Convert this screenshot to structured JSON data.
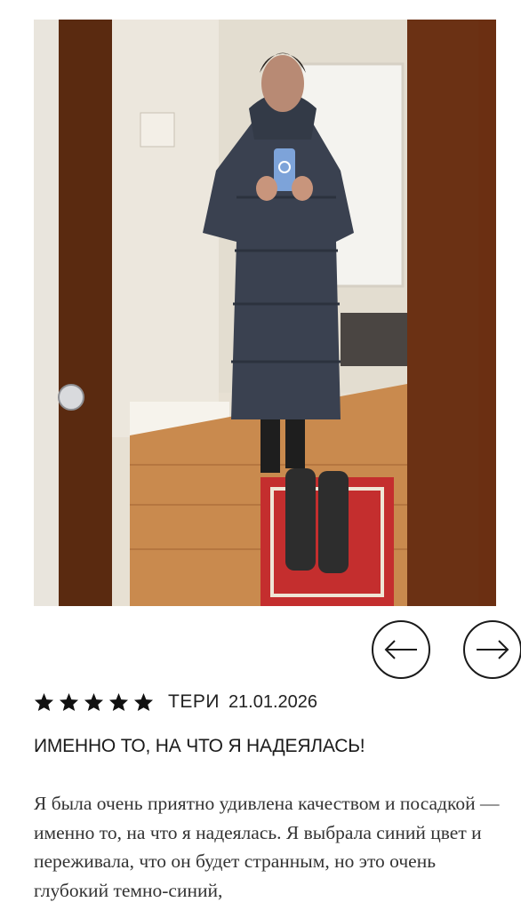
{
  "review": {
    "rating": 5,
    "rating_max": 5,
    "author": "ТЕРИ",
    "date": "21.01.2026",
    "title": "ИМЕННО ТО, НА ЧТО Я НАДЕЯЛАСЬ!",
    "body": "Я была очень приятно удивлена качеством и посадкой — именно то, на что я надеялась. Я выбрала синий цвет и переживала, что он будет странным, но это очень глубокий темно-синий,"
  },
  "gallery": {
    "prev_icon": "arrow-left-icon",
    "next_icon": "arrow-right-icon"
  },
  "colors": {
    "text": "#1a1a1a",
    "body_text": "#333333",
    "star": "#111111",
    "coat": "#3a4150",
    "wood_frame": "#6b2f12",
    "floor": "#c98a4e",
    "rug": "#c42e2e"
  }
}
